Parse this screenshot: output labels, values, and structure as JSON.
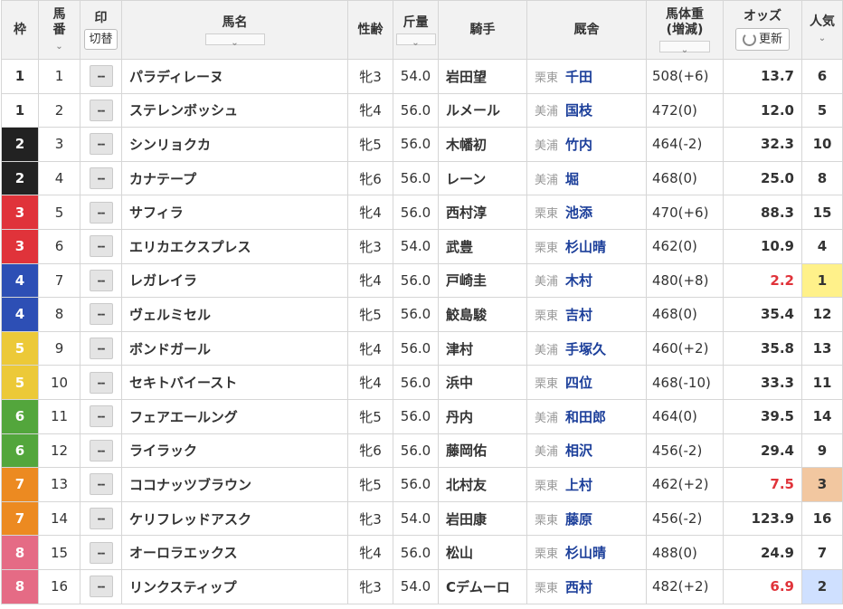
{
  "header": {
    "waku": "枠",
    "umaban": "馬\n番",
    "mark": "印",
    "mark_toggle": "切替",
    "horse_name": "馬名",
    "sex_age": "性齢",
    "kinryo": "斤量",
    "jockey": "騎手",
    "stable": "厩舎",
    "body_weight": "馬体重",
    "body_weight_sub": "(増減)",
    "odds": "オッズ",
    "update_button": "更新",
    "popularity": "人気",
    "sort_arrow": "⌄"
  },
  "mark_placeholder": "--",
  "waku_colors": {
    "1": {
      "bg": "#ffffff",
      "fg": "#333333"
    },
    "2": {
      "bg": "#222222",
      "fg": "#ffffff"
    },
    "3": {
      "bg": "#e0333a",
      "fg": "#ffffff"
    },
    "4": {
      "bg": "#2d4fb5",
      "fg": "#ffffff"
    },
    "5": {
      "bg": "#ecc938",
      "fg": "#ffffff"
    },
    "6": {
      "bg": "#53a63c",
      "fg": "#ffffff"
    },
    "7": {
      "bg": "#ec8a21",
      "fg": "#ffffff"
    },
    "8": {
      "bg": "#e56b85",
      "fg": "#ffffff"
    }
  },
  "popularity_highlight": {
    "1": "#fff18a",
    "2": "#cfe0ff",
    "3": "#f2c7a0"
  },
  "rows": [
    {
      "waku": "1",
      "umaban": "1",
      "horse": "パラディレーヌ",
      "sex_age": "牝3",
      "kinryo": "54.0",
      "jockey": "岩田望",
      "region": "栗東",
      "trainer": "千田",
      "body_weight": "508(+6)",
      "odds": "13.7",
      "hot": false,
      "popularity": "6"
    },
    {
      "waku": "1",
      "umaban": "2",
      "horse": "ステレンボッシュ",
      "sex_age": "牝4",
      "kinryo": "56.0",
      "jockey": "ルメール",
      "region": "美浦",
      "trainer": "国枝",
      "body_weight": "472(0)",
      "odds": "12.0",
      "hot": false,
      "popularity": "5"
    },
    {
      "waku": "2",
      "umaban": "3",
      "horse": "シンリョクカ",
      "sex_age": "牝5",
      "kinryo": "56.0",
      "jockey": "木幡初",
      "region": "美浦",
      "trainer": "竹内",
      "body_weight": "464(-2)",
      "odds": "32.3",
      "hot": false,
      "popularity": "10"
    },
    {
      "waku": "2",
      "umaban": "4",
      "horse": "カナテープ",
      "sex_age": "牝6",
      "kinryo": "56.0",
      "jockey": "レーン",
      "region": "美浦",
      "trainer": "堀",
      "body_weight": "468(0)",
      "odds": "25.0",
      "hot": false,
      "popularity": "8"
    },
    {
      "waku": "3",
      "umaban": "5",
      "horse": "サフィラ",
      "sex_age": "牝4",
      "kinryo": "56.0",
      "jockey": "西村淳",
      "region": "栗東",
      "trainer": "池添",
      "body_weight": "470(+6)",
      "odds": "88.3",
      "hot": false,
      "popularity": "15"
    },
    {
      "waku": "3",
      "umaban": "6",
      "horse": "エリカエクスプレス",
      "sex_age": "牝3",
      "kinryo": "54.0",
      "jockey": "武豊",
      "region": "栗東",
      "trainer": "杉山晴",
      "body_weight": "462(0)",
      "odds": "10.9",
      "hot": false,
      "popularity": "4"
    },
    {
      "waku": "4",
      "umaban": "7",
      "horse": "レガレイラ",
      "sex_age": "牝4",
      "kinryo": "56.0",
      "jockey": "戸崎圭",
      "region": "美浦",
      "trainer": "木村",
      "body_weight": "480(+8)",
      "odds": "2.2",
      "hot": true,
      "popularity": "1"
    },
    {
      "waku": "4",
      "umaban": "8",
      "horse": "ヴェルミセル",
      "sex_age": "牝5",
      "kinryo": "56.0",
      "jockey": "鮫島駿",
      "region": "栗東",
      "trainer": "吉村",
      "body_weight": "468(0)",
      "odds": "35.4",
      "hot": false,
      "popularity": "12"
    },
    {
      "waku": "5",
      "umaban": "9",
      "horse": "ボンドガール",
      "sex_age": "牝4",
      "kinryo": "56.0",
      "jockey": "津村",
      "region": "美浦",
      "trainer": "手塚久",
      "body_weight": "460(+2)",
      "odds": "35.8",
      "hot": false,
      "popularity": "13"
    },
    {
      "waku": "5",
      "umaban": "10",
      "horse": "セキトバイースト",
      "sex_age": "牝4",
      "kinryo": "56.0",
      "jockey": "浜中",
      "region": "栗東",
      "trainer": "四位",
      "body_weight": "468(-10)",
      "odds": "33.3",
      "hot": false,
      "popularity": "11"
    },
    {
      "waku": "6",
      "umaban": "11",
      "horse": "フェアエールング",
      "sex_age": "牝5",
      "kinryo": "56.0",
      "jockey": "丹内",
      "region": "美浦",
      "trainer": "和田郎",
      "body_weight": "464(0)",
      "odds": "39.5",
      "hot": false,
      "popularity": "14"
    },
    {
      "waku": "6",
      "umaban": "12",
      "horse": "ライラック",
      "sex_age": "牝6",
      "kinryo": "56.0",
      "jockey": "藤岡佑",
      "region": "美浦",
      "trainer": "相沢",
      "body_weight": "456(-2)",
      "odds": "29.4",
      "hot": false,
      "popularity": "9"
    },
    {
      "waku": "7",
      "umaban": "13",
      "horse": "ココナッツブラウン",
      "sex_age": "牝5",
      "kinryo": "56.0",
      "jockey": "北村友",
      "region": "栗東",
      "trainer": "上村",
      "body_weight": "462(+2)",
      "odds": "7.5",
      "hot": true,
      "popularity": "3"
    },
    {
      "waku": "7",
      "umaban": "14",
      "horse": "ケリフレッドアスク",
      "sex_age": "牝3",
      "kinryo": "54.0",
      "jockey": "岩田康",
      "region": "栗東",
      "trainer": "藤原",
      "body_weight": "456(-2)",
      "odds": "123.9",
      "hot": false,
      "popularity": "16"
    },
    {
      "waku": "8",
      "umaban": "15",
      "horse": "オーロラエックス",
      "sex_age": "牝4",
      "kinryo": "56.0",
      "jockey": "松山",
      "region": "栗東",
      "trainer": "杉山晴",
      "body_weight": "488(0)",
      "odds": "24.9",
      "hot": false,
      "popularity": "7"
    },
    {
      "waku": "8",
      "umaban": "16",
      "horse": "リンクスティップ",
      "sex_age": "牝3",
      "kinryo": "54.0",
      "jockey": "Cデムーロ",
      "region": "栗東",
      "trainer": "西村",
      "body_weight": "482(+2)",
      "odds": "6.9",
      "hot": true,
      "popularity": "2"
    }
  ]
}
